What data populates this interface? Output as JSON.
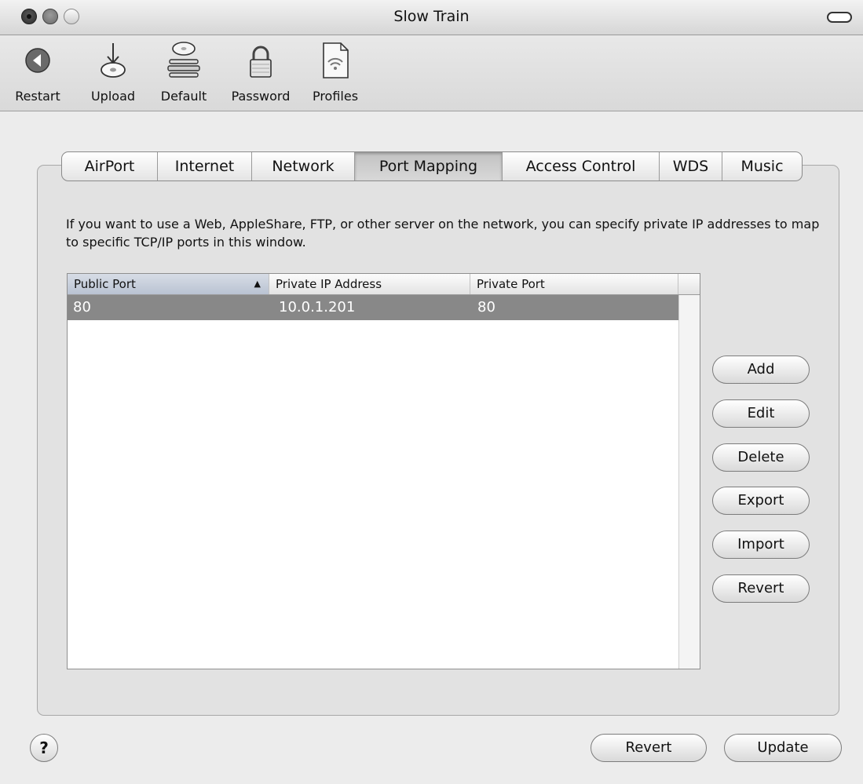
{
  "window": {
    "title": "Slow Train"
  },
  "toolbar": {
    "items": [
      {
        "label": "Restart",
        "icon": "restart-icon"
      },
      {
        "label": "Upload",
        "icon": "upload-icon"
      },
      {
        "label": "Default",
        "icon": "default-icon"
      },
      {
        "label": "Password",
        "icon": "lock-icon"
      },
      {
        "label": "Profiles",
        "icon": "profiles-icon"
      }
    ]
  },
  "tabs": [
    {
      "label": "AirPort"
    },
    {
      "label": "Internet"
    },
    {
      "label": "Network"
    },
    {
      "label": "Port Mapping",
      "selected": true
    },
    {
      "label": "Access Control"
    },
    {
      "label": "WDS"
    },
    {
      "label": "Music"
    }
  ],
  "port_mapping": {
    "description": "If you want to use a Web, AppleShare, FTP, or other server on the network, you can specify private IP addresses to map to specific TCP/IP ports in this window.",
    "columns": [
      "Public Port",
      "Private IP Address",
      "Private Port"
    ],
    "sort_indicator": "▲",
    "rows": [
      {
        "public_port": "80",
        "private_ip": "10.0.1.201",
        "private_port": "80"
      }
    ],
    "buttons": {
      "add": "Add",
      "edit": "Edit",
      "delete": "Delete",
      "export": "Export",
      "import": "Import",
      "revert": "Revert"
    }
  },
  "footer": {
    "help": "?",
    "revert": "Revert",
    "update": "Update"
  }
}
